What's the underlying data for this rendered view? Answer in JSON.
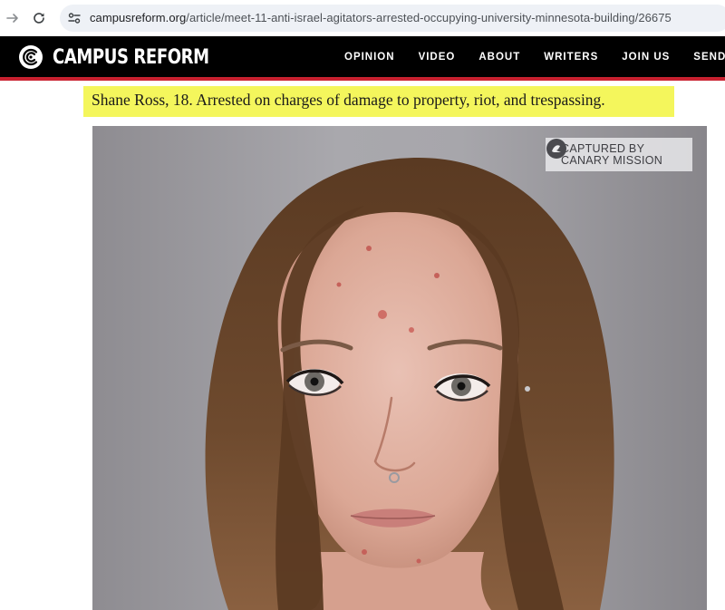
{
  "browser": {
    "url_host": "campusreform.org",
    "url_path": "/article/meet-11-anti-israel-agitators-arrested-occupying-university-minnesota-building/26675"
  },
  "site": {
    "logo_text": "CAMPUS REFORM",
    "accent_color": "#c8202f",
    "nav": [
      {
        "label": "OPINION"
      },
      {
        "label": "VIDEO"
      },
      {
        "label": "ABOUT"
      },
      {
        "label": "WRITERS"
      },
      {
        "label": "JOIN US"
      },
      {
        "label": "SEND A TIP"
      }
    ]
  },
  "article": {
    "caption": "Shane Ross, 18. Arrested on charges of damage to property, riot, and trespassing.",
    "caption_highlight": "#f4f65c",
    "photo": {
      "watermark_line1": "CAPTURED BY",
      "watermark_line2": "CANARY MISSION"
    }
  }
}
